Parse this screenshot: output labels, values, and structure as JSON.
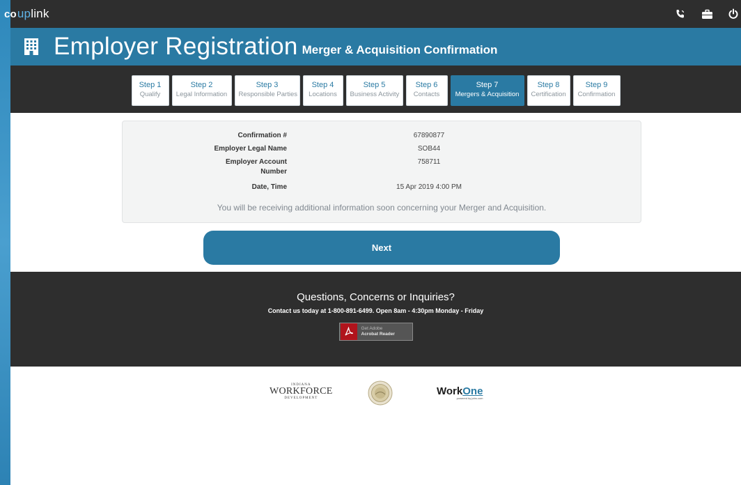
{
  "header": {
    "logo_prefix": "co",
    "logo_highlight": "up",
    "logo_suffix": "link",
    "icons": [
      "phone-icon",
      "briefcase-icon",
      "power-icon"
    ]
  },
  "title": {
    "main": "Employer Registration",
    "sub": "Merger & Acquisition Confirmation",
    "icon": "building-icon"
  },
  "steps": [
    {
      "number": "Step 1",
      "label": "Qualify",
      "active": false
    },
    {
      "number": "Step 2",
      "label": "Legal Information",
      "active": false
    },
    {
      "number": "Step 3",
      "label": "Responsible Parties",
      "active": false
    },
    {
      "number": "Step 4",
      "label": "Locations",
      "active": false
    },
    {
      "number": "Step 5",
      "label": "Business Activity",
      "active": false
    },
    {
      "number": "Step 6",
      "label": "Contacts",
      "active": false
    },
    {
      "number": "Step 7",
      "label": "Mergers & Acquisition",
      "active": true
    },
    {
      "number": "Step 8",
      "label": "Certification",
      "active": false
    },
    {
      "number": "Step 9",
      "label": "Confirmation",
      "active": false
    }
  ],
  "confirmation": {
    "rows": [
      {
        "label": "Confirmation #",
        "value": "67890877"
      },
      {
        "label": "Employer Legal Name",
        "value": "SOB44"
      },
      {
        "label": "Employer Account Number",
        "value": "758711"
      },
      {
        "label": "Date, Time",
        "value": "15 Apr 2019 4:00 PM"
      }
    ],
    "note": "You will be receiving additional information soon concerning your Merger and Acquisition."
  },
  "actions": {
    "next_label": "Next"
  },
  "footer": {
    "title": "Questions, Concerns or Inquiries?",
    "contact": "Contact us today at 1-800-891-6499. Open 8am - 4:30pm Monday - Friday",
    "acrobat_line1": "Get Adobe",
    "acrobat_line2": "Acrobat Reader"
  },
  "logos": {
    "workforce_top": "INDIANA",
    "workforce_main": "WORKFORCE",
    "workforce_bottom": "DEVELOPMENT",
    "workone_work": "Work",
    "workone_one": "One",
    "workone_tag": "powered by jobs.com"
  },
  "colors": {
    "accent": "#2a7aa3",
    "dark": "#2e2e2e",
    "logo_accent": "#5fb3e6"
  }
}
